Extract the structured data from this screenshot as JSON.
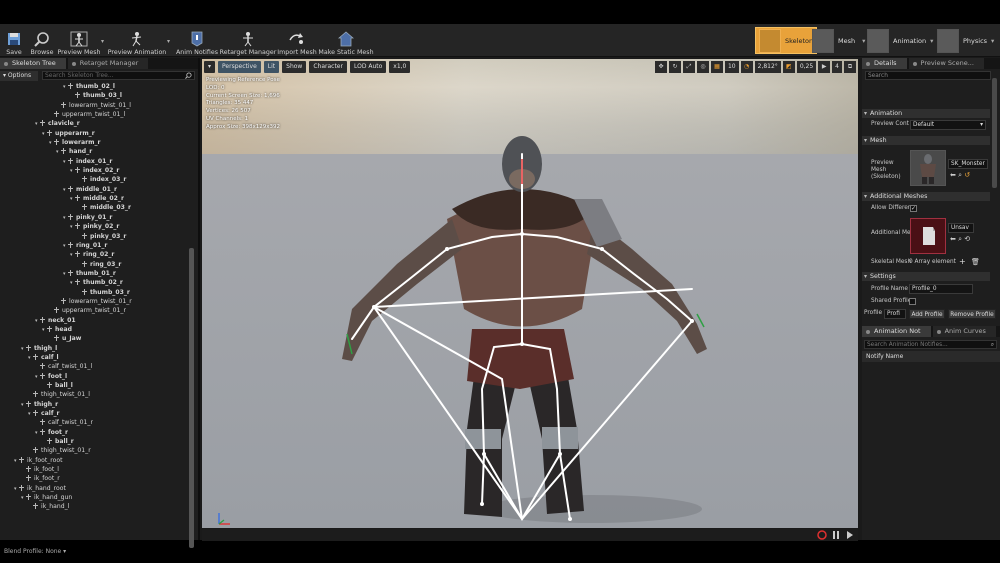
{
  "toolbar": {
    "buttons": [
      {
        "label": "Save",
        "icon": "save-icon"
      },
      {
        "label": "Browse",
        "icon": "browse-icon"
      },
      {
        "label": "Preview Mesh",
        "icon": "preview-mesh-icon"
      },
      {
        "label": "Preview Animation",
        "icon": "preview-animation-icon"
      },
      {
        "label": "Anim Notifies",
        "icon": "anim-notifies-icon"
      },
      {
        "label": "Retarget Manager",
        "icon": "retarget-manager-icon"
      },
      {
        "label": "Import Mesh",
        "icon": "import-mesh-icon"
      },
      {
        "label": "Make Static Mesh",
        "icon": "make-static-mesh-icon"
      }
    ],
    "modes": [
      {
        "label": "Skeleton",
        "active": true
      },
      {
        "label": "Mesh",
        "active": false
      },
      {
        "label": "Animation",
        "active": false
      },
      {
        "label": "Physics",
        "active": false
      }
    ]
  },
  "left_panel": {
    "tabs": [
      "Skeleton Tree",
      "Retarget Manager"
    ],
    "options_label": "Options",
    "search_placeholder": "Search Skeleton Tree...",
    "tree": [
      {
        "name": "thumb_02_l",
        "depth": 7,
        "bold": true,
        "arrow": true
      },
      {
        "name": "thumb_03_l",
        "depth": 8,
        "bold": true,
        "arrow": false
      },
      {
        "name": "lowerarm_twist_01_l",
        "depth": 6,
        "bold": false,
        "arrow": false
      },
      {
        "name": "upperarm_twist_01_l",
        "depth": 5,
        "bold": false,
        "arrow": false
      },
      {
        "name": "clavicle_r",
        "depth": 3,
        "bold": true,
        "arrow": true
      },
      {
        "name": "upperarm_r",
        "depth": 4,
        "bold": true,
        "arrow": true
      },
      {
        "name": "lowerarm_r",
        "depth": 5,
        "bold": true,
        "arrow": true
      },
      {
        "name": "hand_r",
        "depth": 6,
        "bold": true,
        "arrow": true
      },
      {
        "name": "index_01_r",
        "depth": 7,
        "bold": true,
        "arrow": true
      },
      {
        "name": "index_02_r",
        "depth": 8,
        "bold": true,
        "arrow": true
      },
      {
        "name": "index_03_r",
        "depth": 9,
        "bold": true,
        "arrow": false
      },
      {
        "name": "middle_01_r",
        "depth": 7,
        "bold": true,
        "arrow": true
      },
      {
        "name": "middle_02_r",
        "depth": 8,
        "bold": true,
        "arrow": true
      },
      {
        "name": "middle_03_r",
        "depth": 9,
        "bold": true,
        "arrow": false
      },
      {
        "name": "pinky_01_r",
        "depth": 7,
        "bold": true,
        "arrow": true
      },
      {
        "name": "pinky_02_r",
        "depth": 8,
        "bold": true,
        "arrow": true
      },
      {
        "name": "pinky_03_r",
        "depth": 9,
        "bold": true,
        "arrow": false
      },
      {
        "name": "ring_01_r",
        "depth": 7,
        "bold": true,
        "arrow": true
      },
      {
        "name": "ring_02_r",
        "depth": 8,
        "bold": true,
        "arrow": true
      },
      {
        "name": "ring_03_r",
        "depth": 9,
        "bold": true,
        "arrow": false
      },
      {
        "name": "thumb_01_r",
        "depth": 7,
        "bold": true,
        "arrow": true
      },
      {
        "name": "thumb_02_r",
        "depth": 8,
        "bold": true,
        "arrow": true
      },
      {
        "name": "thumb_03_r",
        "depth": 9,
        "bold": true,
        "arrow": false
      },
      {
        "name": "lowerarm_twist_01_r",
        "depth": 6,
        "bold": false,
        "arrow": false
      },
      {
        "name": "upperarm_twist_01_r",
        "depth": 5,
        "bold": false,
        "arrow": false
      },
      {
        "name": "neck_01",
        "depth": 3,
        "bold": true,
        "arrow": true
      },
      {
        "name": "head",
        "depth": 4,
        "bold": true,
        "arrow": true
      },
      {
        "name": "u_Jaw",
        "depth": 5,
        "bold": true,
        "arrow": false
      },
      {
        "name": "thigh_l",
        "depth": 1,
        "bold": true,
        "arrow": true
      },
      {
        "name": "calf_l",
        "depth": 2,
        "bold": true,
        "arrow": true
      },
      {
        "name": "calf_twist_01_l",
        "depth": 3,
        "bold": false,
        "arrow": false
      },
      {
        "name": "foot_l",
        "depth": 3,
        "bold": true,
        "arrow": true
      },
      {
        "name": "ball_l",
        "depth": 4,
        "bold": true,
        "arrow": false
      },
      {
        "name": "thigh_twist_01_l",
        "depth": 2,
        "bold": false,
        "arrow": false
      },
      {
        "name": "thigh_r",
        "depth": 1,
        "bold": true,
        "arrow": true
      },
      {
        "name": "calf_r",
        "depth": 2,
        "bold": true,
        "arrow": true
      },
      {
        "name": "calf_twist_01_r",
        "depth": 3,
        "bold": false,
        "arrow": false
      },
      {
        "name": "foot_r",
        "depth": 3,
        "bold": true,
        "arrow": true
      },
      {
        "name": "ball_r",
        "depth": 4,
        "bold": true,
        "arrow": false
      },
      {
        "name": "thigh_twist_01_r",
        "depth": 2,
        "bold": false,
        "arrow": false
      },
      {
        "name": "ik_foot_root",
        "depth": 0,
        "bold": false,
        "arrow": true
      },
      {
        "name": "ik_foot_l",
        "depth": 1,
        "bold": false,
        "arrow": false
      },
      {
        "name": "ik_foot_r",
        "depth": 1,
        "bold": false,
        "arrow": false
      },
      {
        "name": "ik_hand_root",
        "depth": 0,
        "bold": false,
        "arrow": true
      },
      {
        "name": "ik_hand_gun",
        "depth": 1,
        "bold": false,
        "arrow": true
      },
      {
        "name": "ik_hand_l",
        "depth": 2,
        "bold": false,
        "arrow": false
      },
      {
        "name": "ik_hand_r",
        "depth": 2,
        "bold": false,
        "arrow": false
      }
    ],
    "blend_profile": "Blend Profile: None ▾"
  },
  "viewport": {
    "buttons": [
      "Perspective",
      "Lit",
      "Show",
      "Character",
      "LOD Auto",
      "x1,0"
    ],
    "right_values": [
      "10",
      "2,812°",
      "0,25",
      "4"
    ],
    "stats": [
      "Previewing Reference Pose",
      "LOD: 0",
      "Current Screen Size: 1,696",
      "Triangles: 35 447",
      "Vertices: 26 507",
      "UV Channels: 1",
      "Approx Size: 398x129x392"
    ]
  },
  "right_panel": {
    "tabs": [
      "Details",
      "Preview Scene..."
    ],
    "search_placeholder": "Search",
    "sections": {
      "animation": "Animation",
      "mesh": "Mesh",
      "additional_meshes": "Additional Meshes",
      "settings": "Settings"
    },
    "preview_controller_label": "Preview Cont",
    "preview_controller_value": "Default",
    "preview_mesh_label": "Preview Mesh (Skeleton)",
    "preview_mesh_value": "SK_Monster",
    "allow_different_label": "Allow Differer",
    "additional_mesh_label": "Additional Mes",
    "additional_mesh_value": "Unsav",
    "skeletal_meshes_label": "Skeletal Mesh",
    "skeletal_meshes_value": "0 Array element",
    "profile_name_label": "Profile Name",
    "profile_name_value": "Profile_0",
    "shared_profile_label": "Shared Profile",
    "profile_label": "Profile",
    "profile_dd": "Profi",
    "add_profile": "Add Profile",
    "remove_profile": "Remove Profile",
    "bottom_tabs": [
      "Animation Not",
      "Anim Curves"
    ],
    "notifies_search": "Search Animation Notifies...",
    "notify_name": "Notify Name"
  }
}
